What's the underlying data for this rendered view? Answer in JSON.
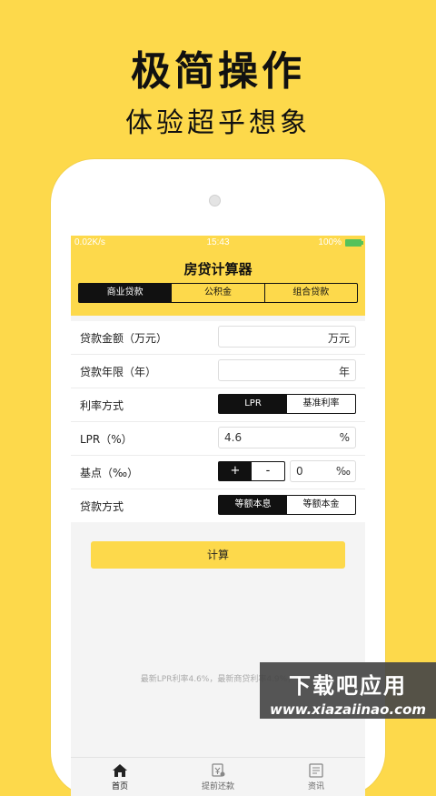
{
  "promo": {
    "title": "极简操作",
    "subtitle": "体验超乎想象"
  },
  "statusbar": {
    "speed": "0.02K/s",
    "time": "15:43",
    "battery": "100%"
  },
  "app": {
    "title": "房贷计算器"
  },
  "tabs": [
    "商业贷款",
    "公积金",
    "组合贷款"
  ],
  "form": {
    "amount": {
      "label": "贷款金额（万元）",
      "unit": "万元"
    },
    "term": {
      "label": "贷款年限（年）",
      "unit": "年"
    },
    "rate_method": {
      "label": "利率方式",
      "options": [
        "LPR",
        "基准利率"
      ]
    },
    "lpr": {
      "label": "LPR（%）",
      "value": "4.6",
      "unit": "%"
    },
    "basis_points": {
      "label": "基点（‰）",
      "plus": "+",
      "minus": "-",
      "value": "0",
      "unit": "‰"
    },
    "repay_method": {
      "label": "贷款方式",
      "options": [
        "等额本息",
        "等额本金"
      ]
    }
  },
  "calculate_label": "计算",
  "footnote": "最新LPR利率4.6%，最新商贷利率4.9%，",
  "tabbar": [
    "首页",
    "提前还款",
    "资讯"
  ],
  "watermark": {
    "big": "下载吧应用",
    "small": "www.xiazaiinao.com"
  }
}
